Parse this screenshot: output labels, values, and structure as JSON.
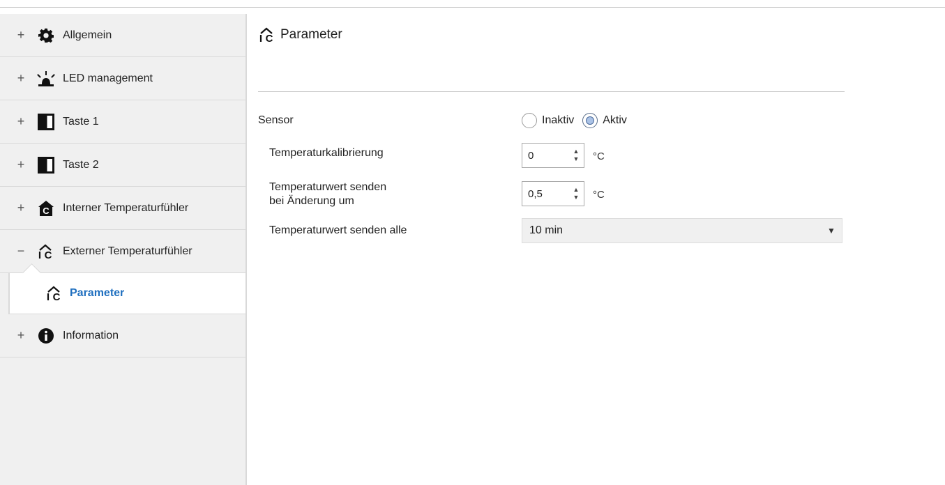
{
  "sidebar": {
    "items": [
      {
        "toggle": "+",
        "label": "Allgemein",
        "icon": "gear-icon"
      },
      {
        "toggle": "+",
        "label": "LED management",
        "icon": "led-light-icon"
      },
      {
        "toggle": "+",
        "label": "Taste 1",
        "icon": "button-half-icon"
      },
      {
        "toggle": "+",
        "label": "Taste 2",
        "icon": "button-half-icon"
      },
      {
        "toggle": "+",
        "label": "Interner Temperaturfühler",
        "icon": "house-celsius-filled-icon"
      },
      {
        "toggle": "−",
        "label": "Externer Temperaturfühler",
        "icon": "house-celsius-outline-icon"
      },
      {
        "toggle": "+",
        "label": "Information",
        "icon": "info-icon"
      }
    ],
    "sub_item": {
      "label": "Parameter",
      "icon": "house-celsius-outline-icon",
      "selected": true
    }
  },
  "main": {
    "title": "Parameter",
    "sensor": {
      "label": "Sensor",
      "options": [
        {
          "label": "Inaktiv",
          "checked": false
        },
        {
          "label": "Aktiv",
          "checked": true
        }
      ]
    },
    "calibration": {
      "label": "Temperaturkalibrierung",
      "value": "0",
      "unit": "°C"
    },
    "send_on_change": {
      "label_line1": "Temperaturwert senden",
      "label_line2": "bei Änderung um",
      "value": "0,5",
      "unit": "°C"
    },
    "send_interval": {
      "label": "Temperaturwert senden alle",
      "value": "10 min"
    }
  },
  "colors": {
    "sidebar_bg": "#f0f0f0",
    "selected_text": "#1f6fbf",
    "select_bg": "#f0f0f0"
  }
}
